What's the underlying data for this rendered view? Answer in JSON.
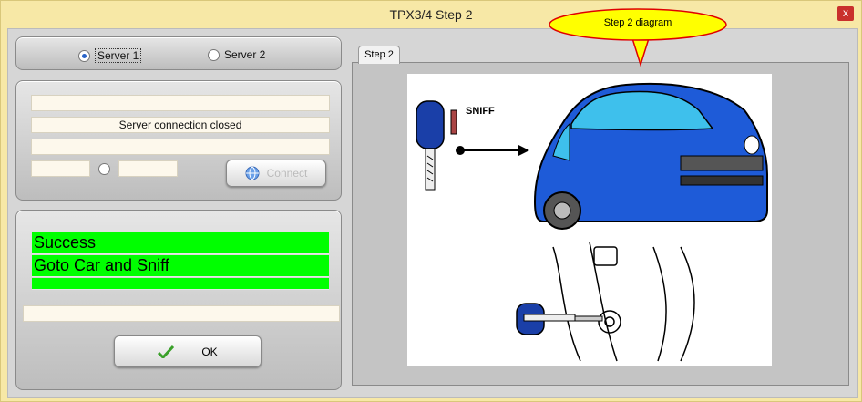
{
  "window": {
    "title": "TPX3/4 Step 2",
    "close_label": "x"
  },
  "callout": {
    "text": "Step 2 diagram"
  },
  "server": {
    "option1": "Server 1",
    "option2": "Server 2",
    "selected": "Server 1"
  },
  "connection": {
    "field1": "",
    "status": "Server connection closed",
    "field3": "",
    "host": "",
    "port": "",
    "connect_label": "Connect"
  },
  "messages": {
    "line1": "Success",
    "line2": "Goto Car and Sniff",
    "line3": "",
    "progress": ""
  },
  "ok_label": "OK",
  "tab": {
    "label": "Step 2"
  },
  "diagram": {
    "sniff_label": "SNIFF"
  },
  "colors": {
    "window_bg": "#f7e8a6",
    "green": "#00ff00",
    "car_blue": "#1e5bd8",
    "callout_yellow": "#ffff00",
    "callout_border": "#e00000"
  }
}
